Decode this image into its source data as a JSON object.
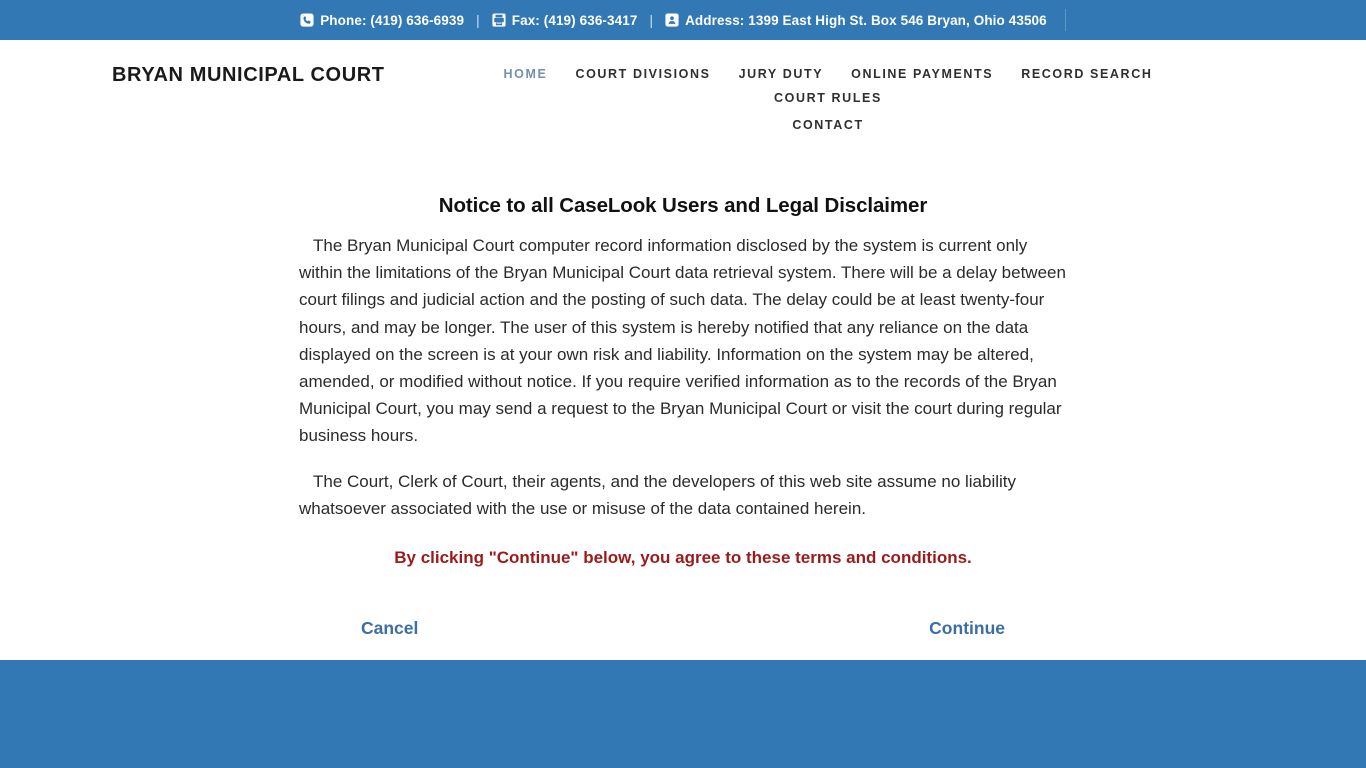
{
  "topbar": {
    "items": [
      {
        "icon": "phone-icon",
        "label": "Phone: (419) 636-6939"
      },
      {
        "icon": "fax-icon",
        "label": "Fax: (419) 636-3417"
      },
      {
        "icon": "address-card-icon",
        "label": "Address: 1399 East High St. Box 546 Bryan, Ohio 43506"
      }
    ],
    "separator": "|",
    "background_color": "#3278b4",
    "text_color": "#ffffff"
  },
  "header": {
    "brand": "BRYAN MUNICIPAL COURT",
    "nav_row1": [
      {
        "label": "HOME",
        "active": true
      },
      {
        "label": "COURT DIVISIONS",
        "active": false
      },
      {
        "label": "JURY DUTY",
        "active": false
      },
      {
        "label": "ONLINE PAYMENTS",
        "active": false
      },
      {
        "label": "RECORD SEARCH",
        "active": false
      },
      {
        "label": "COURT RULES",
        "active": false
      }
    ],
    "nav_row2": [
      {
        "label": "CONTACT",
        "active": false
      }
    ],
    "active_color": "#7590aa",
    "link_color": "#2f2f2f"
  },
  "main": {
    "title": "Notice to all CaseLook Users and Legal Disclaimer",
    "paragraph_1": "The Bryan Municipal Court computer record information disclosed by the system is current only within the limitations of the Bryan Municipal Court data retrieval system. There will be a delay between court filings and judicial action and the posting of such data. The delay could be at least twenty-four hours, and may be longer. The user of this system is hereby notified that any reliance on the data displayed on the screen is at your own risk and liability. Information on the system may be altered, amended, or modified without notice. If you require verified information as to the records of the Bryan Municipal Court, you may send a request to the Bryan Municipal Court or visit the court during regular business hours.",
    "paragraph_2": "The Court, Clerk of Court, their agents, and the developers of this web site assume no liability whatsoever associated with the use or misuse of the data contained herein.",
    "agreement_notice": "By clicking \"Continue\" below, you agree to these terms and conditions.",
    "agreement_color": "#9b1b1b",
    "cancel_label": "Cancel",
    "continue_label": "Continue",
    "action_link_color": "#3a6fa5"
  },
  "footer": {
    "background_color": "#3278b4"
  }
}
